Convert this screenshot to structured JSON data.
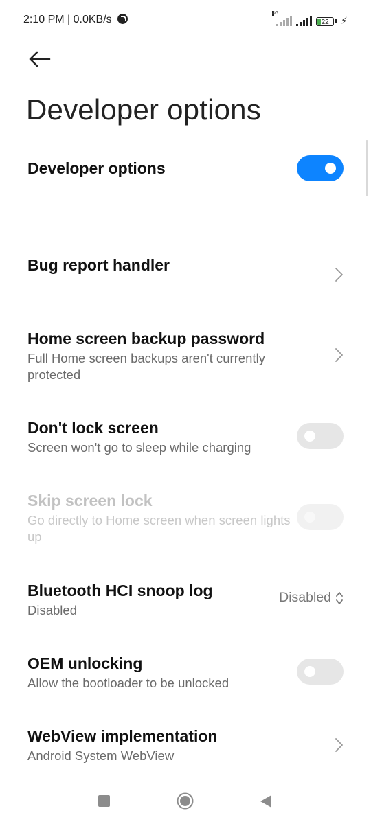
{
  "status_bar": {
    "time": "2:10 PM | 0.0KB/s",
    "network": "4G",
    "battery": "22"
  },
  "page": {
    "title": "Developer options"
  },
  "master_toggle": {
    "label": "Developer options",
    "state": "on"
  },
  "settings": {
    "bug_report": {
      "title": "Bug report handler"
    },
    "backup_password": {
      "title": "Home screen backup password",
      "subtitle": "Full Home screen backups aren't currently protected"
    },
    "dont_lock": {
      "title": "Don't lock screen",
      "subtitle": "Screen won't go to sleep while charging",
      "state": "off"
    },
    "skip_lock": {
      "title": "Skip screen lock",
      "subtitle": "Go directly to Home screen when screen lights up",
      "state": "off",
      "enabled": false
    },
    "bt_snoop": {
      "title": "Bluetooth HCI snoop log",
      "subtitle": "Disabled",
      "value": "Disabled"
    },
    "oem_unlock": {
      "title": "OEM unlocking",
      "subtitle": "Allow the bootloader to be unlocked",
      "state": "off"
    },
    "webview": {
      "title": "WebView implementation",
      "subtitle": "Android System WebView"
    }
  },
  "colors": {
    "accent": "#0d84ff",
    "toggle_off": "#e6e6e6",
    "text_primary": "#111111",
    "text_secondary": "#6b6b6b",
    "text_disabled": "#c2c2c2"
  }
}
